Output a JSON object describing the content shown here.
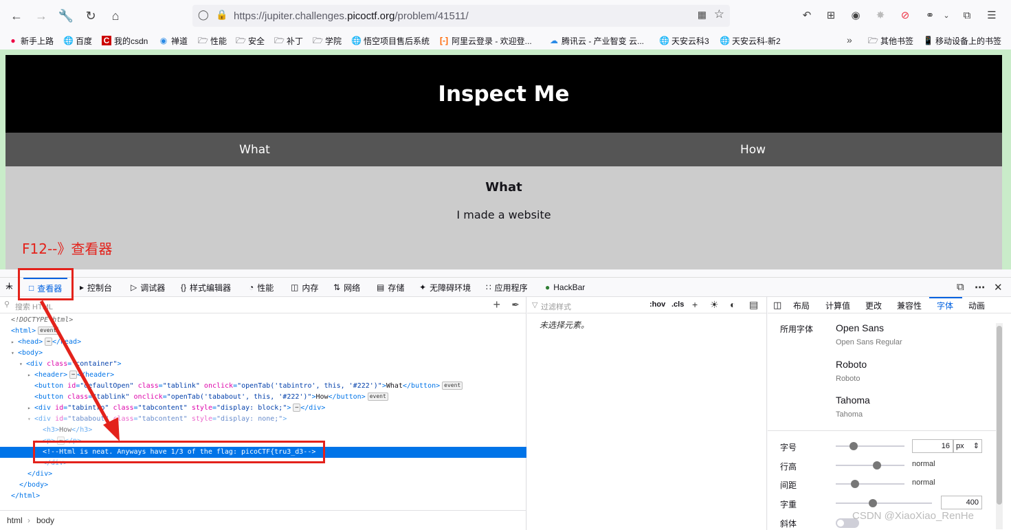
{
  "browser": {
    "url_prefix": "https://jupiter.challenges.",
    "url_domain": "picoctf.org",
    "url_suffix": "/problem/41511/"
  },
  "bookmarks": [
    "新手上路",
    "百度",
    "我的csdn",
    "禅道",
    "性能",
    "安全",
    "补丁",
    "学院",
    "悟空项目售后系统",
    "阿里云登录 - 欢迎登...",
    "腾讯云 - 产业智变 云...",
    "天安云科3",
    "天安云科-新2"
  ],
  "bookmarks_right": [
    "其他书签",
    "移动设备上的书签"
  ],
  "page": {
    "title": "Inspect Me",
    "tab_what": "What",
    "tab_how": "How",
    "section_heading": "What",
    "section_text": "I made a website"
  },
  "annotation": "F12--》查看器",
  "devtools": {
    "tabs": [
      "查看器",
      "控制台",
      "调试器",
      "样式编辑器",
      "性能",
      "内存",
      "网络",
      "存储",
      "无障碍环境",
      "应用程序",
      "HackBar"
    ],
    "search_placeholder": "搜索 HTML",
    "filter_placeholder": "过滤样式",
    "hov": ":hov",
    "cls": ".cls",
    "no_selection": "未选择元素。",
    "breadcrumb": [
      "html",
      "body"
    ],
    "font_tabs": [
      "布局",
      "计算值",
      "更改",
      "兼容性",
      "字体",
      "动画"
    ],
    "fonts_used_label": "所用字体",
    "fonts": [
      {
        "name": "Open Sans",
        "sub": "Open Sans Regular"
      },
      {
        "name": "Roboto",
        "sub": "Roboto"
      },
      {
        "name": "Tahoma",
        "sub": "Tahoma"
      }
    ],
    "props": {
      "size_label": "字号",
      "size_value": "16",
      "size_unit": "px",
      "line_label": "行高",
      "line_value": "normal",
      "spacing_label": "间距",
      "spacing_value": "normal",
      "weight_label": "字重",
      "weight_value": "400",
      "italic_label": "斜体"
    }
  },
  "html_tree": {
    "doctype": "<!DOCTYPE html>",
    "comment": "<!--Html is neat. Anyways have 1/3 of the flag: picoCTF{tru3_d3-->",
    "btn1_text": "What",
    "btn2_text": "How",
    "h3_text": "How",
    "event": "event"
  },
  "watermark": "CSDN @XiaoXiao_RenHe"
}
